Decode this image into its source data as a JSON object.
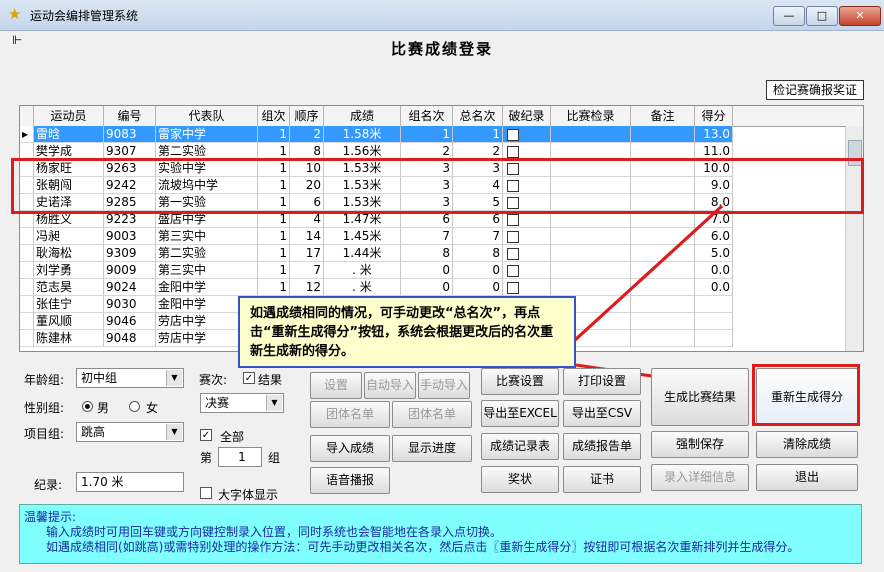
{
  "window": {
    "title": "运动会编排管理系统",
    "minimize": "—",
    "maximize": "□",
    "close": "✕"
  },
  "page_title": "比赛成绩登录",
  "stamp_text": "检记赛确报奖证",
  "grid": {
    "columns": [
      "运动员",
      "编号",
      "代表队",
      "组次",
      "顺序",
      "成绩",
      "组名次",
      "总名次",
      "破纪录",
      "比赛检录",
      "备注",
      "得分"
    ],
    "rows": [
      {
        "name": "雷晗",
        "id": "9083",
        "team": "雷家中学",
        "group": "1",
        "order": "2",
        "score": "1.58米",
        "grank": "1",
        "trank": "1",
        "score_pts": "13.0",
        "selected": true
      },
      {
        "name": "樊学成",
        "id": "9307",
        "team": "第二实验",
        "group": "1",
        "order": "8",
        "score": "1.56米",
        "grank": "2",
        "trank": "2",
        "score_pts": "11.0",
        "selected": false
      },
      {
        "name": "杨家旺",
        "id": "9263",
        "team": "实验中学",
        "group": "1",
        "order": "10",
        "score": "1.53米",
        "grank": "3",
        "trank": "3",
        "score_pts": "10.0",
        "selected": false
      },
      {
        "name": "张朝闯",
        "id": "9242",
        "team": "流坡坞中学",
        "group": "1",
        "order": "20",
        "score": "1.53米",
        "grank": "3",
        "trank": "4",
        "score_pts": "9.0",
        "selected": false
      },
      {
        "name": "史诺泽",
        "id": "9285",
        "team": "第一实验",
        "group": "1",
        "order": "6",
        "score": "1.53米",
        "grank": "3",
        "trank": "5",
        "score_pts": "8.0",
        "selected": false
      },
      {
        "name": "杨胜义",
        "id": "9223",
        "team": "盛店中学",
        "group": "1",
        "order": "4",
        "score": "1.47米",
        "grank": "6",
        "trank": "6",
        "score_pts": "7.0",
        "selected": false
      },
      {
        "name": "冯昶",
        "id": "9003",
        "team": "第三实中",
        "group": "1",
        "order": "14",
        "score": "1.45米",
        "grank": "7",
        "trank": "7",
        "score_pts": "6.0",
        "selected": false
      },
      {
        "name": "耿海松",
        "id": "9309",
        "team": "第二实验",
        "group": "1",
        "order": "17",
        "score": "1.44米",
        "grank": "8",
        "trank": "8",
        "score_pts": "5.0",
        "selected": false
      },
      {
        "name": "刘学勇",
        "id": "9009",
        "team": "第三实中",
        "group": "1",
        "order": "7",
        "score": ". 米",
        "grank": "0",
        "trank": "0",
        "score_pts": "0.0",
        "selected": false
      },
      {
        "name": "范志昊",
        "id": "9024",
        "team": "金阳中学",
        "group": "1",
        "order": "12",
        "score": ". 米",
        "grank": "0",
        "trank": "0",
        "score_pts": "0.0",
        "selected": false
      },
      {
        "name": "张佳宁",
        "id": "9030",
        "team": "金阳中学",
        "group": "",
        "order": "",
        "score": "",
        "grank": "",
        "trank": "",
        "score_pts": "",
        "selected": false
      },
      {
        "name": "董风顺",
        "id": "9046",
        "team": "劳店中学",
        "group": "",
        "order": "",
        "score": "",
        "grank": "",
        "trank": "",
        "score_pts": "",
        "selected": false
      },
      {
        "name": "陈建林",
        "id": "9048",
        "team": "劳店中学",
        "group": "",
        "order": "",
        "score": "",
        "grank": "",
        "trank": "",
        "score_pts": "",
        "selected": false
      }
    ]
  },
  "callout": "如遇成绩相同的情况，可手动更改“总名次”，再点击“重新生成得分”按钮，系统会根据更改后的名次重新生成新的得分。",
  "filters": {
    "age_label": "年龄组:",
    "age_value": "初中组",
    "gender_label": "性别组:",
    "gender_male": "男",
    "gender_female": "女",
    "gender_selected": "男",
    "event_label": "项目组:",
    "event_value": "跳高",
    "record_label": "纪录:",
    "record_value": "1.70 米"
  },
  "round": {
    "label": "赛次:",
    "result_label": "结果",
    "value": "决赛",
    "all_label": "全部",
    "group_prefix": "第",
    "group_value": "1",
    "group_suffix": "组",
    "bigfont_label": "大字体显示"
  },
  "buttons": {
    "settings": "设置",
    "auto_import": "自动导入",
    "manual_import": "手动导入",
    "team_list": "团体名单",
    "team_list2": "团体名单",
    "import_scores": "导入成绩",
    "show_progress": "显示进度",
    "voice": "语音播报",
    "match_settings": "比赛设置",
    "print_settings": "打印设置",
    "gen_results": "生成比赛结果",
    "export_excel": "导出至EXCEL",
    "export_csv": "导出至CSV",
    "regen_score": "重新生成得分",
    "score_record": "成绩记录表",
    "score_report": "成绩报告单",
    "force_save": "强制保存",
    "clear_scores": "清除成绩",
    "award": "奖状",
    "certificate": "证书",
    "enter_details": "录入详细信息",
    "exit": "退出"
  },
  "tips": {
    "title": "温馨提示:",
    "line1": "输入成绩时可用回车键或方向键控制录入位置，同时系统也会智能地在各录入点切换。",
    "line2": "如遇成绩相同(如跳高)或需特别处理的操作方法：可先手动更改相关名次，然后点击〖重新生成得分〗按钮即可根据名次重新排列并生成得分。"
  }
}
